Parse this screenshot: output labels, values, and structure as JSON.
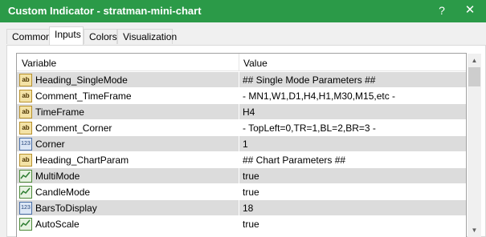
{
  "window": {
    "title": "Custom Indicator - stratman-mini-chart",
    "help_label": "?",
    "close_label": "✕"
  },
  "tabs": [
    {
      "label": "Common",
      "active": false
    },
    {
      "label": "Inputs",
      "active": true
    },
    {
      "label": "Colors",
      "active": false
    },
    {
      "label": "Visualization",
      "active": false
    }
  ],
  "table": {
    "columns": [
      "Variable",
      "Value"
    ],
    "rows": [
      {
        "icon": "ab",
        "icon_name": "string-icon",
        "icon_text": "ab",
        "variable": "Heading_SingleMode",
        "value": "## Single Mode Parameters ##",
        "shaded": true
      },
      {
        "icon": "ab",
        "icon_name": "string-icon",
        "icon_text": "ab",
        "variable": "Comment_TimeFrame",
        "value": " - MN1,W1,D1,H4,H1,M30,M15,etc -",
        "shaded": false
      },
      {
        "icon": "ab",
        "icon_name": "string-icon",
        "icon_text": "ab",
        "variable": "TimeFrame",
        "value": "H4",
        "shaded": true
      },
      {
        "icon": "ab",
        "icon_name": "string-icon",
        "icon_text": "ab",
        "variable": "Comment_Corner",
        "value": " - TopLeft=0,TR=1,BL=2,BR=3 -",
        "shaded": false
      },
      {
        "icon": "num",
        "icon_name": "integer-icon",
        "icon_text": "123",
        "variable": "Corner",
        "value": "1",
        "shaded": true
      },
      {
        "icon": "ab",
        "icon_name": "string-icon",
        "icon_text": "ab",
        "variable": "Heading_ChartParam",
        "value": "## Chart Parameters ##",
        "shaded": false
      },
      {
        "icon": "bool",
        "icon_name": "boolean-icon",
        "icon_text": "",
        "variable": "MultiMode",
        "value": "true",
        "shaded": true
      },
      {
        "icon": "bool",
        "icon_name": "boolean-icon",
        "icon_text": "",
        "variable": "CandleMode",
        "value": "true",
        "shaded": false
      },
      {
        "icon": "num",
        "icon_name": "integer-icon",
        "icon_text": "123",
        "variable": "BarsToDisplay",
        "value": "18",
        "shaded": true
      },
      {
        "icon": "bool",
        "icon_name": "boolean-icon",
        "icon_text": "",
        "variable": "AutoScale",
        "value": "true",
        "shaded": false
      }
    ]
  },
  "colors": {
    "titlebar": "#2b9a48",
    "row_shade": "#dcdcdc"
  }
}
